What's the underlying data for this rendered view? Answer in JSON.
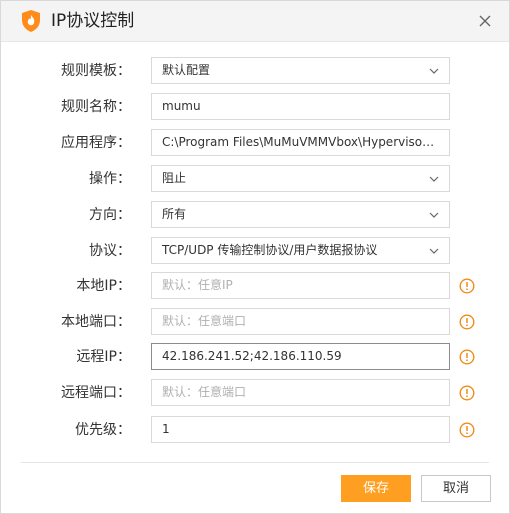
{
  "window": {
    "title": "IP协议控制",
    "close_icon": "close-icon",
    "logo_icon": "shield-logo-icon",
    "accent_color": "#ff9f22"
  },
  "form": {
    "rule_template": {
      "label": "规则模板：",
      "value": "默认配置"
    },
    "rule_name": {
      "label": "规则名称：",
      "value": "mumu"
    },
    "application": {
      "label": "应用程序：",
      "value": "C:\\Program Files\\MuMuVMMVbox\\Hypervisor\\MuMuVMMHeadless.exe"
    },
    "action": {
      "label": "操作：",
      "value": "阻止"
    },
    "direction": {
      "label": "方向：",
      "value": "所有"
    },
    "protocol": {
      "label": "协议：",
      "value": "TCP/UDP 传输控制协议/用户数据报协议"
    },
    "local_ip": {
      "label": "本地IP：",
      "placeholder": "默认：任意IP"
    },
    "local_port": {
      "label": "本地端口：",
      "placeholder": "默认：任意端口"
    },
    "remote_ip": {
      "label": "远程IP：",
      "value": "42.186.241.52;42.186.110.59"
    },
    "remote_port": {
      "label": "远程端口：",
      "placeholder": "默认：任意端口"
    },
    "priority": {
      "label": "优先级：",
      "value": "1"
    }
  },
  "buttons": {
    "save_label": "保存",
    "cancel_label": "取消"
  }
}
